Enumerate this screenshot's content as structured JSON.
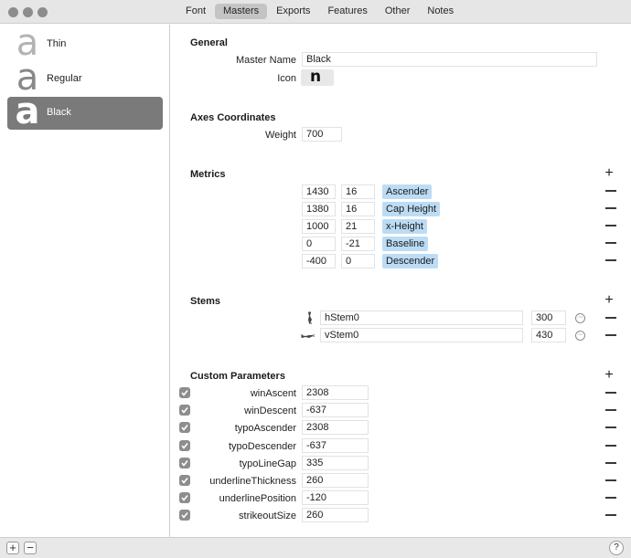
{
  "window": {
    "tabs": [
      {
        "label": "Font",
        "active": false
      },
      {
        "label": "Masters",
        "active": true
      },
      {
        "label": "Exports",
        "active": false
      },
      {
        "label": "Features",
        "active": false
      },
      {
        "label": "Other",
        "active": false
      },
      {
        "label": "Notes",
        "active": false
      }
    ]
  },
  "sidebar": {
    "masters": [
      {
        "glyph": "a",
        "label": "Thin",
        "selected": false
      },
      {
        "glyph": "a",
        "label": "Regular",
        "selected": false
      },
      {
        "glyph": "a",
        "label": "Black",
        "selected": true
      }
    ]
  },
  "bottom_bar": {
    "add": "+",
    "remove": "−",
    "help": "?"
  },
  "general": {
    "title": "General",
    "master_name_label": "Master Name",
    "master_name_value": "Black",
    "icon_label": "Icon",
    "icon_glyph": "n"
  },
  "axes": {
    "title": "Axes Coordinates",
    "weight_label": "Weight",
    "weight_value": "700"
  },
  "metrics": {
    "title": "Metrics",
    "rows": [
      {
        "value": "1430",
        "overshoot": "16",
        "name": "Ascender"
      },
      {
        "value": "1380",
        "overshoot": "16",
        "name": "Cap Height"
      },
      {
        "value": "1000",
        "overshoot": "21",
        "name": "x-Height"
      },
      {
        "value": "0",
        "overshoot": "-21",
        "name": "Baseline"
      },
      {
        "value": "-400",
        "overshoot": "0",
        "name": "Descender"
      }
    ]
  },
  "stems": {
    "title": "Stems",
    "rows": [
      {
        "name": "hStem0",
        "value": "300",
        "icon": "horizontal-stem-icon"
      },
      {
        "name": "vStem0",
        "value": "430",
        "icon": "vertical-stem-icon"
      }
    ]
  },
  "custom_parameters": {
    "title": "Custom Parameters",
    "rows": [
      {
        "name": "winAscent",
        "value": "2308",
        "checked": true
      },
      {
        "name": "winDescent",
        "value": "-637",
        "checked": true
      },
      {
        "name": "typoAscender",
        "value": "2308",
        "checked": true
      },
      {
        "name": "typoDescender",
        "value": "-637",
        "checked": true
      },
      {
        "name": "typoLineGap",
        "value": "335",
        "checked": true
      },
      {
        "name": "underlineThickness",
        "value": "260",
        "checked": true
      },
      {
        "name": "underlinePosition",
        "value": "-120",
        "checked": true
      },
      {
        "name": "strikeoutSize",
        "value": "260",
        "checked": true
      }
    ]
  },
  "colors": {
    "metric_tag": "#bcdcf5",
    "selection": "#7a7a7a"
  }
}
